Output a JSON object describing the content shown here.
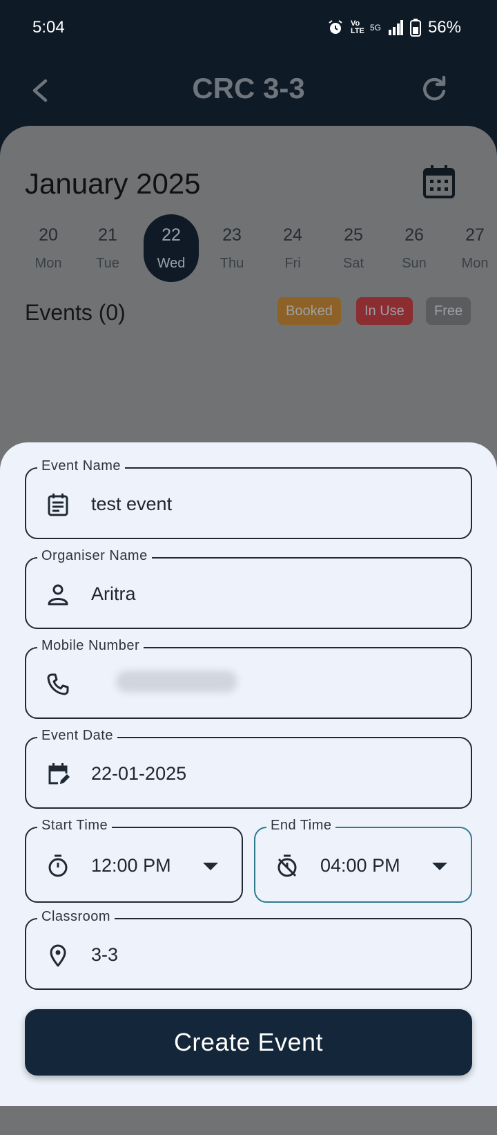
{
  "status": {
    "time": "5:04",
    "network": "5G",
    "volte": "Vo LTE",
    "battery": "56%"
  },
  "appbar": {
    "title": "CRC 3-3"
  },
  "calendar": {
    "month": "January 2025",
    "days": [
      {
        "num": "20",
        "wd": "Mon"
      },
      {
        "num": "21",
        "wd": "Tue"
      },
      {
        "num": "22",
        "wd": "Wed"
      },
      {
        "num": "23",
        "wd": "Thu"
      },
      {
        "num": "24",
        "wd": "Fri"
      },
      {
        "num": "25",
        "wd": "Sat"
      },
      {
        "num": "26",
        "wd": "Sun"
      },
      {
        "num": "27",
        "wd": "Mon"
      }
    ],
    "selected_day": "22"
  },
  "events": {
    "title": "Events (0)",
    "legend": {
      "booked": "Booked",
      "in_use": "In Use",
      "free": "Free"
    }
  },
  "form": {
    "event_name": {
      "label": "Event Name",
      "value": "test event"
    },
    "organiser_name": {
      "label": "Organiser Name",
      "value": "Aritra"
    },
    "mobile_number": {
      "label": "Mobile Number"
    },
    "event_date": {
      "label": "Event Date",
      "value": "22-01-2025"
    },
    "start_time": {
      "label": "Start Time",
      "value": "12:00 PM"
    },
    "end_time": {
      "label": "End Time",
      "value": "04:00 PM"
    },
    "classroom": {
      "label": "Classroom",
      "value": "3-3"
    },
    "submit_label": "Create Event"
  },
  "colors": {
    "primary": "#142639",
    "booked": "#8e6126",
    "in_use": "#8b2d31",
    "free": "#5b5c5e",
    "focus": "#2f7a90"
  }
}
